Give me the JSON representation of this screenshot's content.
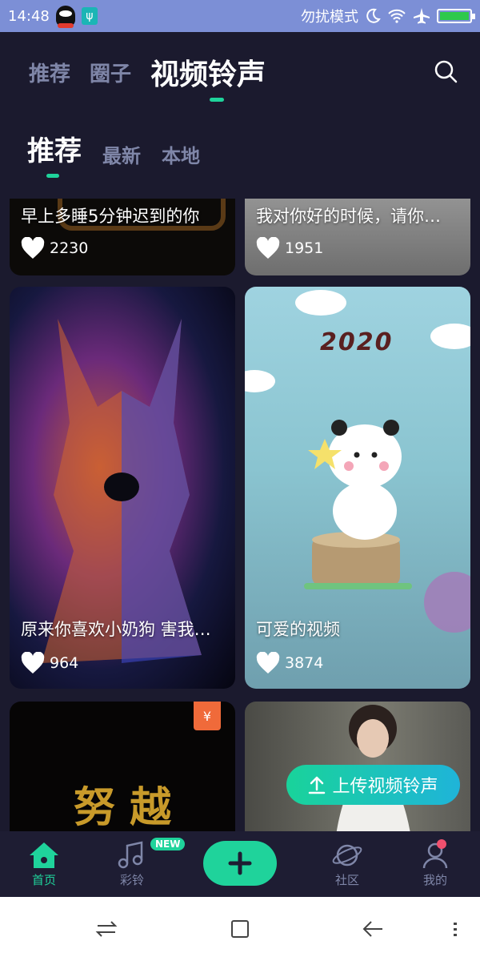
{
  "status_bar": {
    "time": "14:48",
    "dnd_text": "勿扰模式",
    "icons": [
      "qq-icon",
      "usb-icon",
      "moon-icon",
      "wifi-icon",
      "airplane-icon",
      "battery-icon"
    ],
    "battery_level": 1.0
  },
  "top_tabs": [
    {
      "label": "推荐"
    },
    {
      "label": "圈子"
    },
    {
      "label": "视频铃声",
      "active": true
    }
  ],
  "sub_tabs": [
    {
      "label": "推荐",
      "active": true
    },
    {
      "label": "最新"
    },
    {
      "label": "本地"
    }
  ],
  "cards": [
    {
      "title": "早上多睡5分钟迟到的你",
      "likes": "2230"
    },
    {
      "title": "我对你好的时候，请你…",
      "likes": "1951"
    },
    {
      "title": "原来你喜欢小奶狗 害我…",
      "likes": "964"
    },
    {
      "title": "可爱的视频",
      "likes": "3874",
      "overlay_text": "2020"
    },
    {
      "title": "",
      "likes": "",
      "overlay_text": "努 越",
      "price_tag": "¥"
    },
    {
      "title": "",
      "likes": ""
    }
  ],
  "upload_button": {
    "label": "上传视频铃声"
  },
  "bottom_nav": [
    {
      "label": "首页",
      "active": true
    },
    {
      "label": "彩铃",
      "badge": "NEW"
    },
    {
      "label": ""
    },
    {
      "label": "社区"
    },
    {
      "label": "我的"
    }
  ],
  "colors": {
    "accent": "#1fd39b",
    "background": "#1b1a2e",
    "inactive": "#7f86a8",
    "status_bar": "#7c8fd6"
  }
}
